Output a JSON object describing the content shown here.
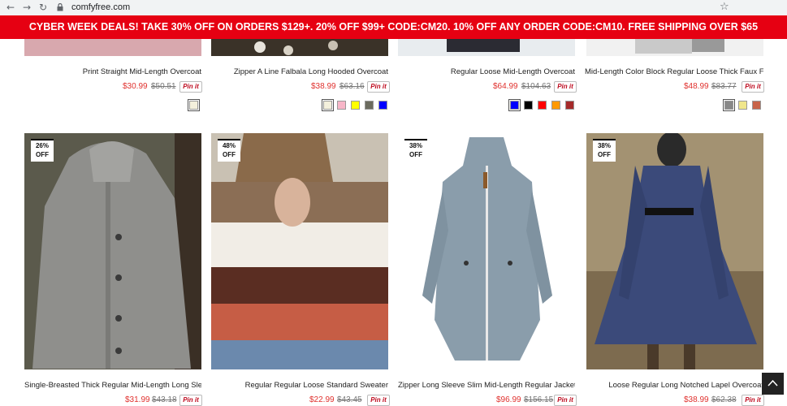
{
  "browser": {
    "url": "comfyfree.com",
    "icons": [
      "back-arrow-icon",
      "forward-arrow-icon",
      "reload-icon",
      "lock-icon",
      "star-icon"
    ]
  },
  "banner": {
    "text": "CYBER WEEK DEALS! TAKE 30% OFF ON ORDERS $129+. 20% OFF $99+ CODE:CM20. 10% OFF ANY ORDER CODE:CM10. FREE SHIPPING OVER $65",
    "bg_color": "#e60012"
  },
  "pin_label": "Pin it",
  "top_row": [
    {
      "name": "Print Straight Mid-Length Overcoat",
      "price": "$30.99",
      "old_price": "$50.51",
      "swatches": [
        "#f4f0dc"
      ]
    },
    {
      "name": "Zipper A Line Falbala Long Hooded Overcoat",
      "price": "$38.99",
      "old_price": "$63.16",
      "swatches": [
        "#f4f0dc",
        "#f7b6c8",
        "#ffff00",
        "#6b6b5e",
        "#0000ff"
      ]
    },
    {
      "name": "Regular Loose Mid-Length Overcoat",
      "price": "$64.99",
      "old_price": "$104.63",
      "swatches": [
        "#0000ff",
        "#000000",
        "#ff0000",
        "#ff9900",
        "#a52a2a"
      ]
    },
    {
      "name": "Mid-Length Color Block Regular Loose Thick Faux Fur O...",
      "price": "$48.99",
      "old_price": "$83.77",
      "swatches": [
        "#888888",
        "#f0e68c",
        "#c8644a"
      ]
    }
  ],
  "bottom_row": [
    {
      "discount": "26%",
      "off": "OFF",
      "name": "Single-Breasted Thick Regular Mid-Length Long Sleeve ...",
      "price": "$31.99",
      "old_price": "$43.18"
    },
    {
      "discount": "48%",
      "off": "OFF",
      "name": "Regular Regular Loose Standard Sweater",
      "price": "$22.99",
      "old_price": "$43.45"
    },
    {
      "discount": "38%",
      "off": "OFF",
      "name": "Zipper Long Sleeve Slim Mid-Length Regular Jacket",
      "price": "$96.99",
      "old_price": "$156.15"
    },
    {
      "discount": "38%",
      "off": "OFF",
      "name": "Loose Regular Long Notched Lapel Overcoat",
      "price": "$38.99",
      "old_price": "$62.38"
    }
  ]
}
